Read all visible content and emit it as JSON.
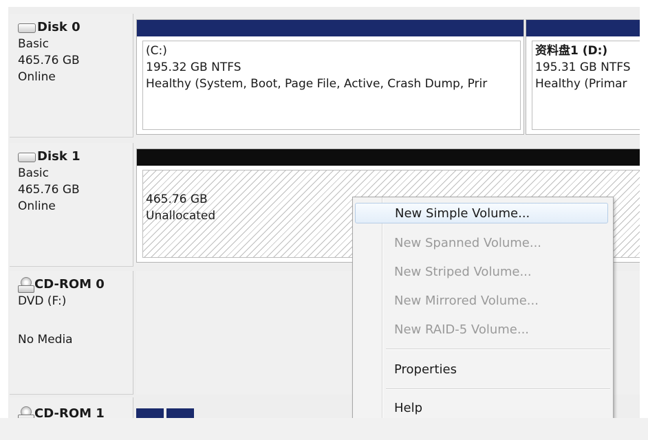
{
  "disks": [
    {
      "name": "Disk 0",
      "type": "Basic",
      "size": "465.76 GB",
      "status": "Online",
      "volumes": [
        {
          "name": "(C:)",
          "detail": "195.32 GB NTFS",
          "health": "Healthy (System, Boot, Page File, Active, Crash Dump, Prir"
        },
        {
          "name": "资料盘1  (D:)",
          "detail": "195.31 GB NTFS",
          "health": "Healthy (Primar"
        }
      ]
    },
    {
      "name": "Disk 1",
      "type": "Basic",
      "size": "465.76 GB",
      "status": "Online",
      "unallocated": {
        "size": "465.76 GB",
        "label": "Unallocated"
      }
    }
  ],
  "cdroms": [
    {
      "name": "CD-ROM 0",
      "drive": "DVD (F:)",
      "media": "No Media"
    },
    {
      "name": "CD-ROM 1"
    }
  ],
  "context_menu": {
    "items": [
      {
        "label": "New Simple Volume...",
        "enabled": true,
        "highlighted": true
      },
      {
        "label": "New Spanned Volume...",
        "enabled": false
      },
      {
        "label": "New Striped Volume...",
        "enabled": false
      },
      {
        "label": "New Mirrored Volume...",
        "enabled": false
      },
      {
        "label": "New RAID-5 Volume...",
        "enabled": false
      },
      {
        "label": "Properties",
        "enabled": true
      },
      {
        "label": "Help",
        "enabled": true
      }
    ]
  },
  "colors": {
    "primary_partition": "#1a2a6c",
    "unallocated_header": "#0d0d0d",
    "menu_highlight": "#e3eef9"
  }
}
